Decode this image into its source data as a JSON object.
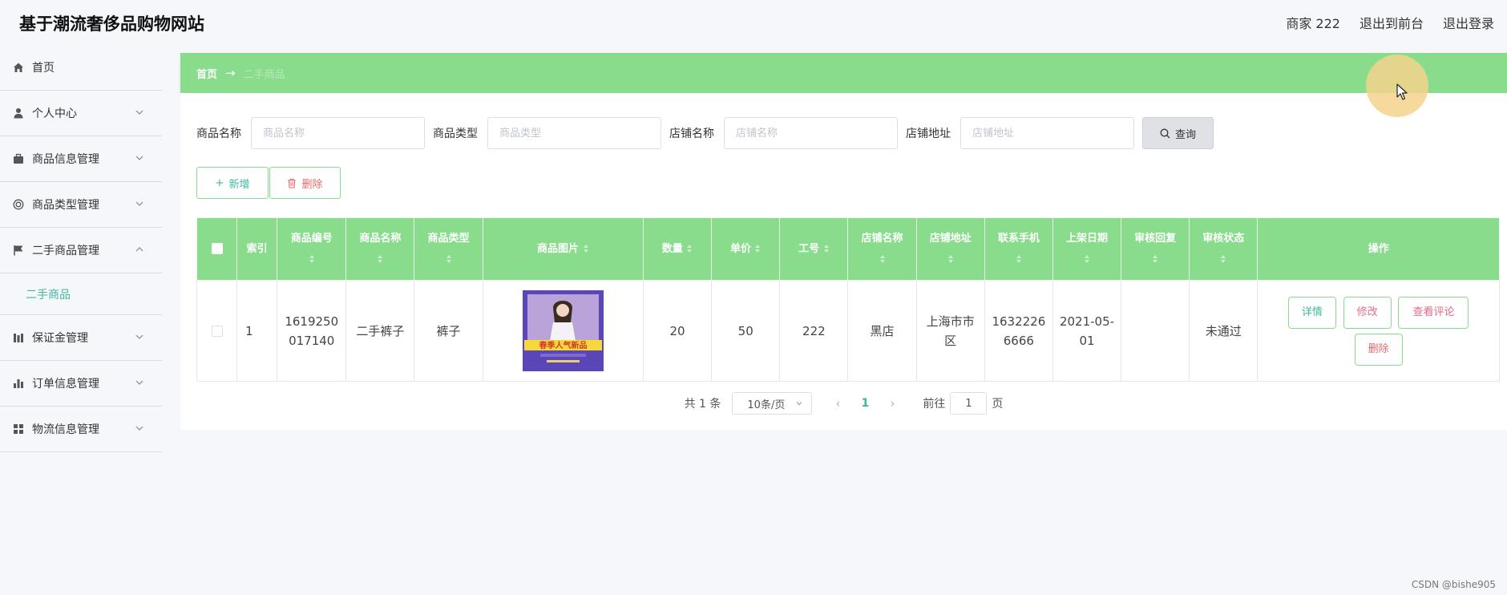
{
  "header": {
    "site_title": "基于潮流奢侈品购物网站",
    "user": "商家 222",
    "to_front": "退出到前台",
    "logout": "退出登录"
  },
  "sidebar": {
    "items": [
      {
        "label": "首页",
        "icon": "home-icon"
      },
      {
        "label": "个人中心",
        "icon": "user-icon"
      },
      {
        "label": "商品信息管理",
        "icon": "briefcase-icon"
      },
      {
        "label": "商品类型管理",
        "icon": "ring-icon"
      },
      {
        "label": "二手商品管理",
        "icon": "flag-icon"
      },
      {
        "label": "保证金管理",
        "icon": "bars-icon"
      },
      {
        "label": "订单信息管理",
        "icon": "chart-icon"
      },
      {
        "label": "物流信息管理",
        "icon": "grid-icon"
      }
    ],
    "sub_item": "二手商品"
  },
  "breadcrumb": {
    "home": "首页",
    "arrow": "→",
    "current": "二手商品"
  },
  "search": {
    "fields": [
      {
        "label": "商品名称",
        "placeholder": "商品名称"
      },
      {
        "label": "商品类型",
        "placeholder": "商品类型"
      },
      {
        "label": "店铺名称",
        "placeholder": "店铺名称"
      },
      {
        "label": "店铺地址",
        "placeholder": "店铺地址"
      }
    ],
    "button": "查询"
  },
  "actions": {
    "add": "新增",
    "delete": "删除"
  },
  "table": {
    "headers": {
      "index": "索引",
      "code": "商品编号",
      "name": "商品名称",
      "type": "商品类型",
      "image": "商品图片",
      "qty": "数量",
      "price": "单价",
      "emp_no": "工号",
      "shop_name": "店铺名称",
      "shop_addr": "店铺地址",
      "phone": "联系手机",
      "date": "上架日期",
      "review_reply": "审核回复",
      "review_status": "审核状态",
      "ops": "操作"
    },
    "rows": [
      {
        "index": "1",
        "code": "1619250017140",
        "name": "二手裤子",
        "type": "裤子",
        "qty": "20",
        "price": "50",
        "emp_no": "222",
        "shop_name": "黑店",
        "shop_addr": "上海市市区",
        "phone": "16322266666",
        "date": "2021-05-01",
        "review_reply": "",
        "review_status": "未通过",
        "image_banner": "春季人气新品"
      }
    ],
    "ops": {
      "detail": "详情",
      "edit": "修改",
      "review": "查看评论",
      "delete": "删除"
    }
  },
  "pager": {
    "total": "共 1 条",
    "page_size": "10条/页",
    "current": "1",
    "goto_label": "前往",
    "goto_value": "1",
    "page_suffix": "页"
  },
  "watermark": "CSDN @bishe905",
  "colors": {
    "accent": "#88dc8b",
    "link": "#3fb8a0",
    "danger": "#e46a6a"
  }
}
